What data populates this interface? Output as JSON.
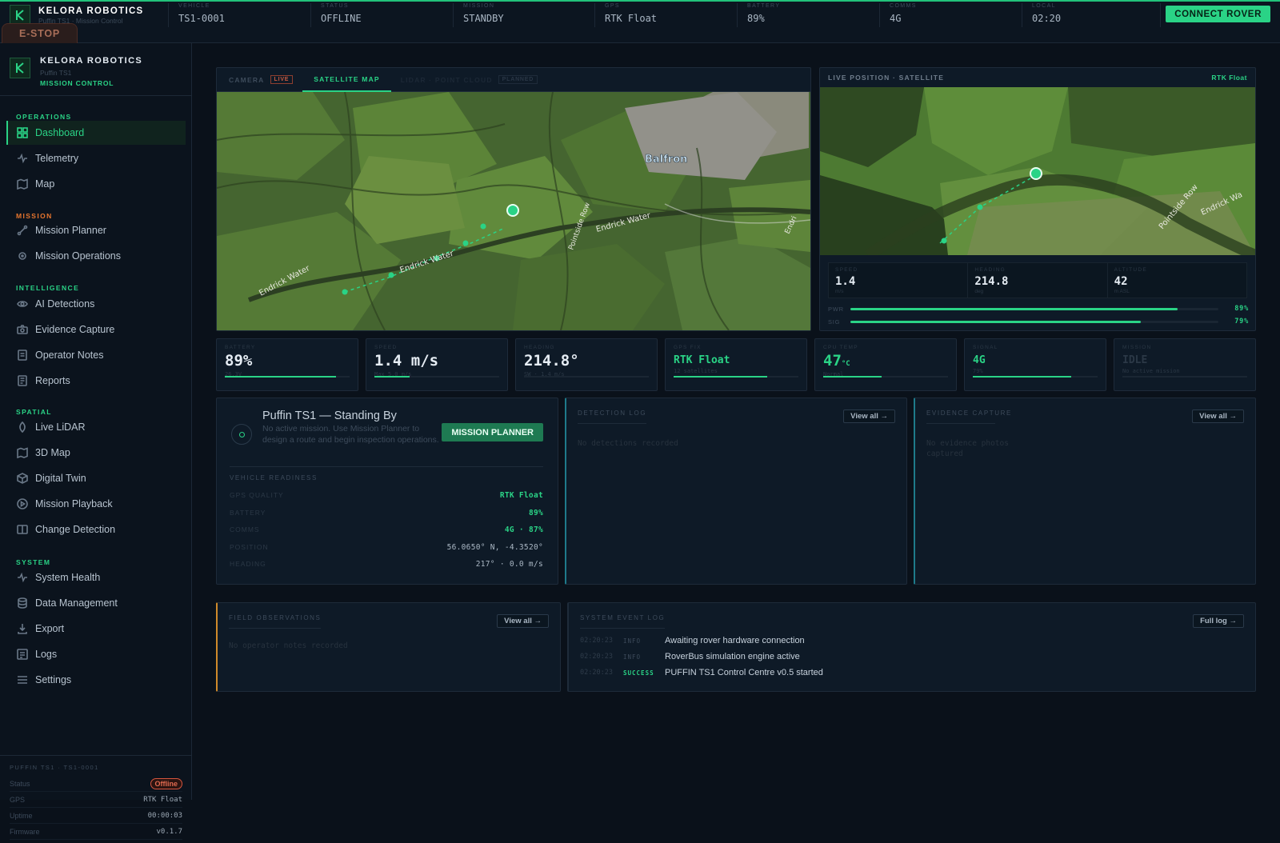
{
  "topbar": {
    "brand": "KELORA ROBOTICS",
    "subtitle": "Puffin TS1 · Mission Control",
    "stats": [
      {
        "label": "VEHICLE",
        "value": "TS1-0001"
      },
      {
        "label": "STATUS",
        "value": "OFFLINE"
      },
      {
        "label": "MISSION",
        "value": "STANDBY"
      },
      {
        "label": "GPS",
        "value": "RTK Float"
      },
      {
        "label": "BATTERY",
        "value": "89%"
      },
      {
        "label": "COMMS",
        "value": "4G"
      },
      {
        "label": "LOCAL",
        "value": "02:20"
      }
    ],
    "connect_label": "CONNECT ROVER",
    "estop_label": "E-STOP"
  },
  "sidebar": {
    "brand": "KELORA ROBOTICS",
    "model": "Puffin TS1",
    "tagline": "MISSION CONTROL",
    "sections": [
      {
        "title": "OPERATIONS",
        "color": "#2ad386",
        "items": [
          "Dashboard",
          "Telemetry",
          "Map"
        ]
      },
      {
        "title": "MISSION",
        "color": "#e8762e",
        "items": [
          "Mission Planner",
          "Mission Operations"
        ]
      },
      {
        "title": "INTELLIGENCE",
        "color": "#2ad386",
        "items": [
          "AI Detections",
          "Evidence Capture",
          "Operator Notes",
          "Reports"
        ]
      },
      {
        "title": "SPATIAL",
        "color": "#2ad386",
        "items": [
          "Live LiDAR",
          "3D Map",
          "Digital Twin",
          "Mission Playback",
          "Change Detection"
        ]
      },
      {
        "title": "SYSTEM",
        "color": "#2ad386",
        "items": [
          "System Health",
          "Data Management",
          "Export",
          "Logs",
          "Settings"
        ]
      }
    ],
    "active_item": "Dashboard",
    "footer": {
      "title": "PUFFIN TS1 · TS1-0001",
      "rows": [
        {
          "label": "Status",
          "value": "Offline"
        },
        {
          "label": "GPS",
          "value": "RTK Float"
        },
        {
          "label": "Uptime",
          "value": "00:00:03"
        },
        {
          "label": "Firmware",
          "value": "v0.1.7"
        }
      ]
    }
  },
  "camera_panel": {
    "tabs": [
      {
        "label": "CAMERA",
        "badge": "LIVE"
      },
      {
        "label": "SATELLITE MAP",
        "badge": ""
      },
      {
        "label": "LIDAR · POINT CLOUD",
        "badge": "PLANNED"
      }
    ],
    "active_tab": "SATELLITE MAP",
    "map_labels": [
      "Balfron",
      "Endrick Water",
      "Endrick Water",
      "Endrick Water",
      "Pointside Row",
      "Endri"
    ]
  },
  "live_position": {
    "title": "LIVE POSITION · SATELLITE",
    "gps_state": "RTK Float",
    "map_labels": [
      "Pointside Row",
      "Endrick Wa"
    ],
    "stats": [
      {
        "label": "SPEED",
        "value": "1.4",
        "unit": "m/s"
      },
      {
        "label": "HEADING",
        "value": "214.8",
        "unit": "deg"
      },
      {
        "label": "ALTITUDE",
        "value": "42",
        "unit": "m ASL"
      }
    ],
    "bars": [
      {
        "label": "PWR",
        "value": 89,
        "text": "89%"
      },
      {
        "label": "SIG",
        "value": 79,
        "text": "79%"
      }
    ]
  },
  "metrics": [
    {
      "label": "BATTERY",
      "value": "89%",
      "sub": "26.3V",
      "level": 0.89,
      "green": false
    },
    {
      "label": "SPEED",
      "value": "1.4 m/s",
      "sub": "Max 5.0 m/s",
      "level": 0.28,
      "green": false
    },
    {
      "label": "HEADING",
      "value": "214.8°",
      "sub": "SW · 1.4 m/s",
      "level": 0,
      "green": false
    },
    {
      "label": "GPS FIX",
      "value": "RTK Float",
      "sub": "12 satellites",
      "level": 0.75,
      "green": true
    },
    {
      "label": "CPU TEMP",
      "value": "47",
      "unit": "°C",
      "sub": "Normal",
      "level": 0.47,
      "green": true
    },
    {
      "label": "SIGNAL",
      "value": "4G",
      "sub": "79%",
      "level": 0.79,
      "green": true
    },
    {
      "label": "MISSION",
      "value": "IDLE",
      "sub": "No active mission",
      "level": 0,
      "green": false
    }
  ],
  "standby": {
    "title": "Puffin TS1 — Standing By",
    "description": "No active mission. Use Mission Planner to design a route and begin inspection operations.",
    "button": "MISSION PLANNER",
    "readiness_title": "VEHICLE READINESS",
    "readiness": [
      {
        "label": "GPS QUALITY",
        "value": "RTK Float"
      },
      {
        "label": "BATTERY",
        "value": "89%"
      },
      {
        "label": "COMMS",
        "value": "4G · 87%"
      },
      {
        "label": "POSITION",
        "value": "56.0650° N, -4.3520°"
      },
      {
        "label": "HEADING",
        "value": "217° · 0.0 m/s"
      }
    ]
  },
  "detection_log": {
    "title": "DETECTION LOG",
    "view_all": "View all →",
    "empty": "No detections recorded"
  },
  "evidence": {
    "title": "EVIDENCE CAPTURE",
    "view_all": "View all →",
    "empty": "No evidence photos captured"
  },
  "field_obs": {
    "title": "FIELD OBSERVATIONS",
    "view_all": "View all →",
    "empty": "No operator notes recorded"
  },
  "system_log": {
    "title": "SYSTEM EVENT LOG",
    "button": "Full log →",
    "events": [
      {
        "time": "02:20:23",
        "level": "INFO",
        "message": "Awaiting rover hardware connection"
      },
      {
        "time": "02:20:23",
        "level": "INFO",
        "message": "RoverBus simulation engine active"
      },
      {
        "time": "02:20:23",
        "level": "SUCCESS",
        "message": "PUFFIN TS1 Control Centre v0.5 started"
      }
    ]
  }
}
